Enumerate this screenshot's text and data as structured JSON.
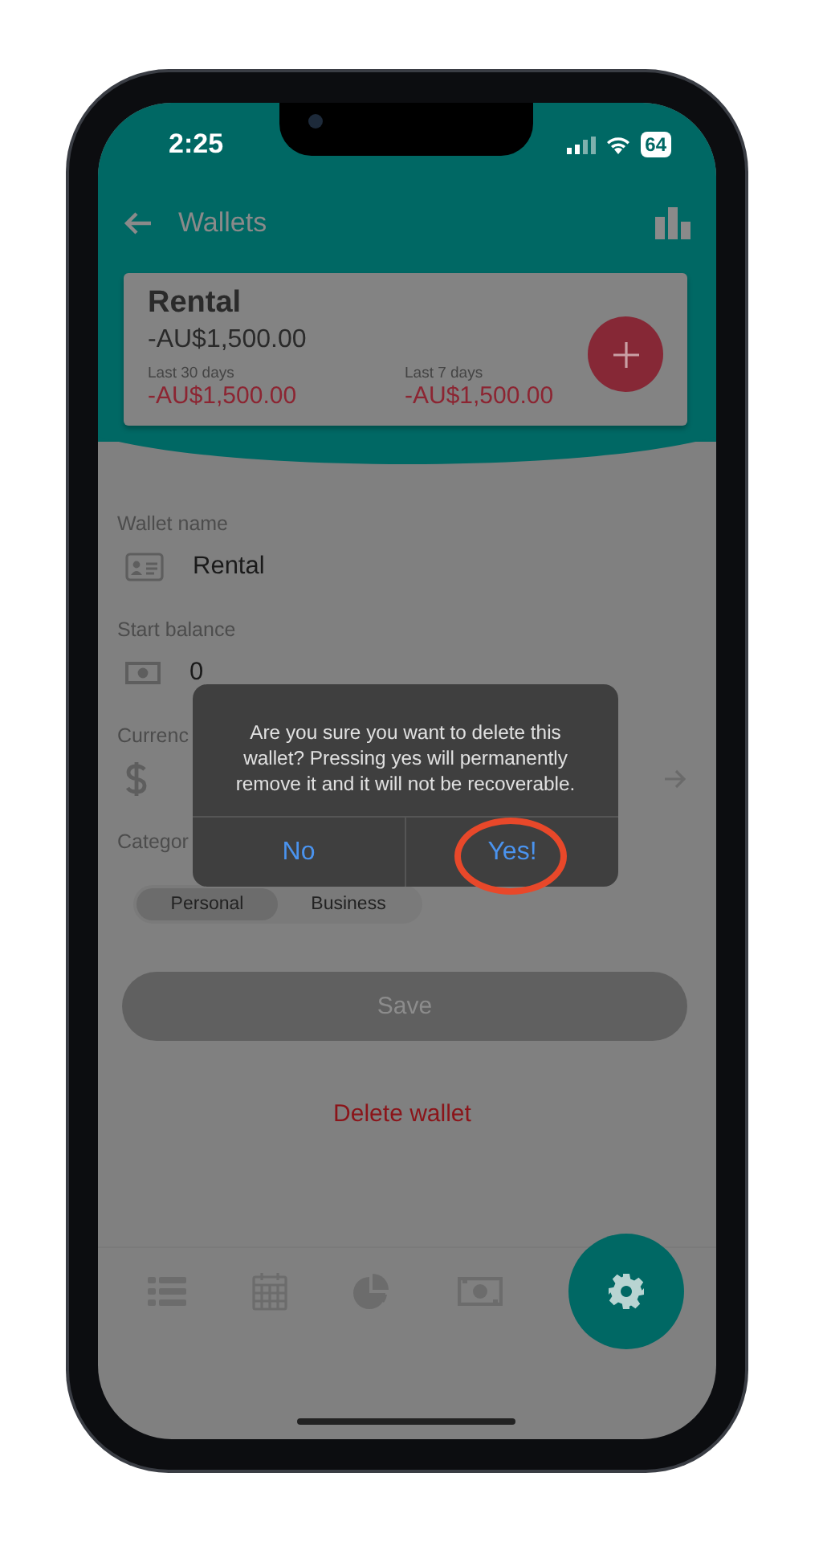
{
  "status_bar": {
    "time": "2:25",
    "battery": "64"
  },
  "header": {
    "title": "Wallets"
  },
  "wallet_card": {
    "name": "Rental",
    "balance": "-AU$1,500.00",
    "stats": [
      {
        "label": "Last 30 days",
        "value": "-AU$1,500.00"
      },
      {
        "label": "Last 7 days",
        "value": "-AU$1,500.00"
      }
    ]
  },
  "form": {
    "wallet_name": {
      "label": "Wallet name",
      "value": "Rental"
    },
    "start_balance": {
      "label": "Start balance",
      "value": "0"
    },
    "currency": {
      "label": "Currenc"
    },
    "category": {
      "label": "Categor",
      "options": [
        {
          "label": "Personal",
          "selected": true
        },
        {
          "label": "Business",
          "selected": false
        }
      ]
    }
  },
  "save_button": {
    "label": "Save",
    "disabled": true
  },
  "delete_link": "Delete wallet",
  "bottom_nav": [
    {
      "kind": "list",
      "selected": false
    },
    {
      "kind": "calendar",
      "selected": false
    },
    {
      "kind": "chart",
      "selected": false
    },
    {
      "kind": "money",
      "selected": false
    },
    {
      "kind": "settings",
      "selected": true
    }
  ],
  "dialog": {
    "message": "Are you sure you want to delete this wallet? Pressing yes will permanently remove it and it will not be recoverable.",
    "buttons": [
      {
        "label": "No",
        "circled": false
      },
      {
        "label": "Yes!",
        "circled": true
      }
    ]
  }
}
